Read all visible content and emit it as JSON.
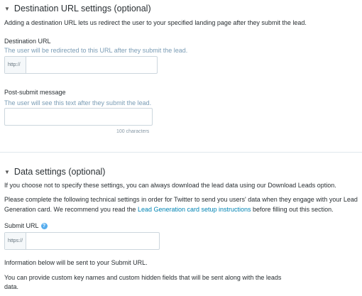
{
  "destination": {
    "section_title": "Destination URL settings (optional)",
    "description": "Adding a destination URL lets us redirect the user to your specified landing page after they submit the lead.",
    "url_label": "Destination URL",
    "url_hint": "The user will be redirected to this URL after they submit the lead.",
    "url_prefix": "http://",
    "url_value": "",
    "post_submit_label": "Post-submit message",
    "post_submit_hint": "The user will see this text after they submit the lead.",
    "post_submit_value": "",
    "char_count": "100 characters"
  },
  "data_settings": {
    "section_title": "Data settings (optional)",
    "intro": "If you choose not to specify these settings, you can always download the lead data using our Download Leads option.",
    "para_line1": "Please complete the following technical settings in order for Twitter to send you users' data when they engage with your Lead",
    "para_line2_pre": "Generation card. We recommend you read the ",
    "para_link": "Lead Generation card setup instructions",
    "para_line2_post": " before filling out this section.",
    "submit_url_label": "Submit URL",
    "submit_url_prefix": "https://",
    "submit_url_value": "",
    "info_text": "Information below will be sent to your Submit URL.",
    "custom_line1": "You can provide custom key names and custom hidden fields that will be sent along with the leads",
    "custom_line2": "data."
  },
  "icons": {
    "collapse": "triangle-down-icon",
    "help": "question-circle-icon"
  },
  "colors": {
    "link": "#0084b4",
    "hint": "#7a9cb5",
    "help_icon": "#55acee"
  }
}
